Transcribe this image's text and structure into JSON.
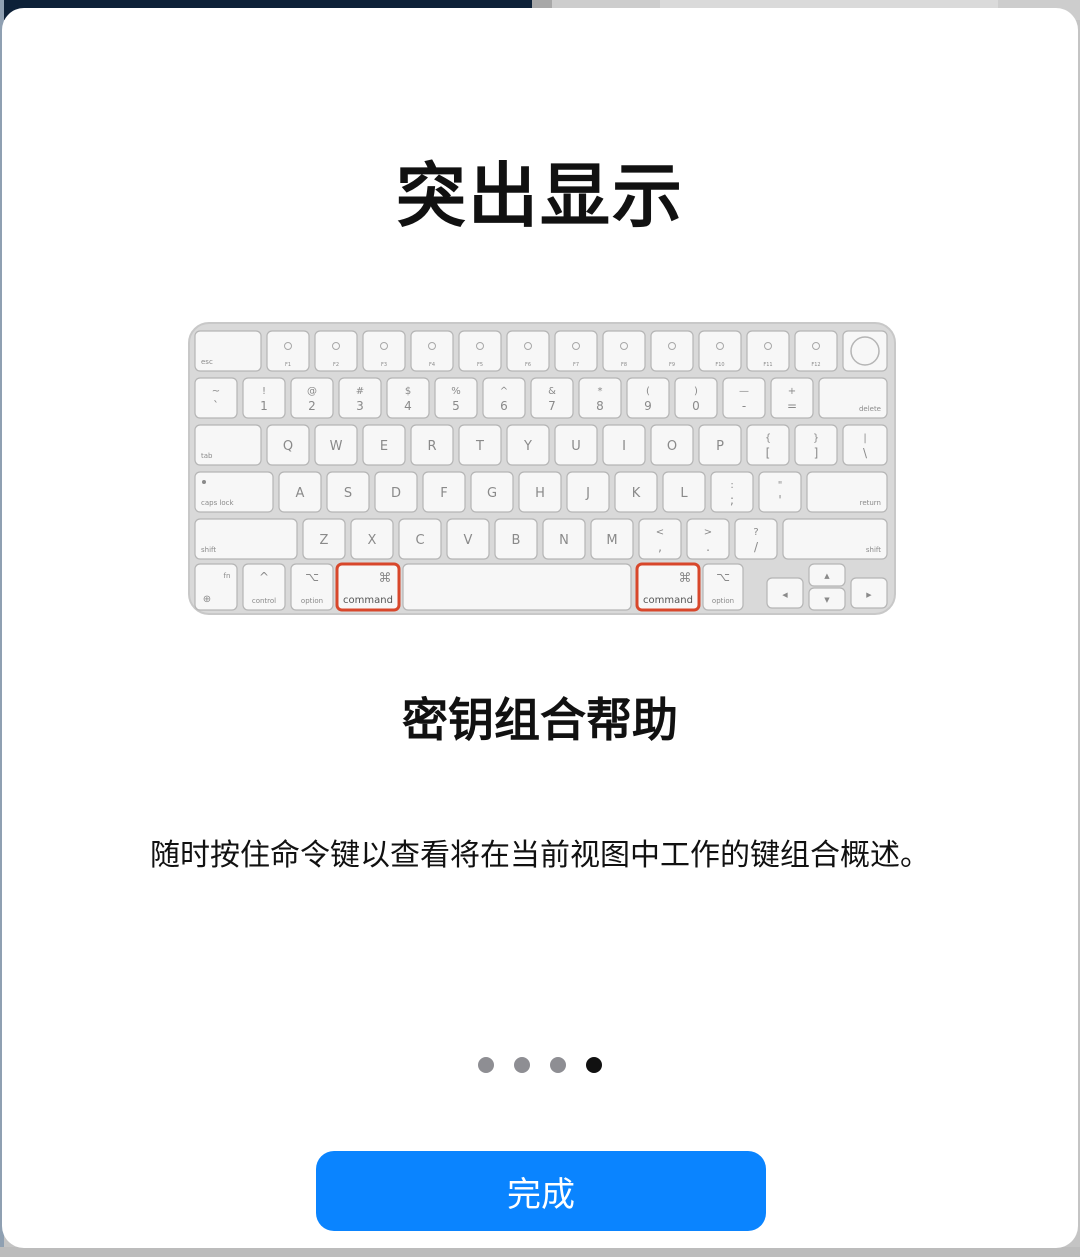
{
  "dialog": {
    "title": "突出显示",
    "subtitle": "密钥组合帮助",
    "description": "随时按住命令键以查看将在当前视图中工作的键组合概述。",
    "done_label": "完成",
    "active_page": 4,
    "page_count": 4
  },
  "colors": {
    "accent": "#0a84ff",
    "highlight": "#d8472b"
  },
  "keyboard": {
    "highlighted_label": "command",
    "highlighted_symbol": "⌘",
    "rows": [
      [
        "esc",
        "F1",
        "F2",
        "F3",
        "F4",
        "F5",
        "F6",
        "F7",
        "F8",
        "F9",
        "F10",
        "F11",
        "F12",
        "touch-id"
      ],
      [
        [
          "~",
          "`"
        ],
        [
          "!",
          "1"
        ],
        [
          "@",
          "2"
        ],
        [
          "#",
          "3"
        ],
        [
          "$",
          "4"
        ],
        [
          "%",
          "5"
        ],
        [
          "^",
          "6"
        ],
        [
          "&",
          "7"
        ],
        [
          "*",
          "8"
        ],
        [
          "(",
          "9"
        ],
        [
          ")",
          "0"
        ],
        [
          "—",
          "-"
        ],
        [
          "+",
          "="
        ],
        "delete"
      ],
      [
        "tab",
        "Q",
        "W",
        "E",
        "R",
        "T",
        "Y",
        "U",
        "I",
        "O",
        "P",
        [
          "{",
          "["
        ],
        [
          "}",
          "]"
        ],
        [
          "|",
          "\\"
        ]
      ],
      [
        "caps lock",
        "A",
        "S",
        "D",
        "F",
        "G",
        "H",
        "J",
        "K",
        "L",
        [
          ":",
          ";"
        ],
        [
          "\"",
          "'"
        ],
        "return"
      ],
      [
        "shift",
        "Z",
        "X",
        "C",
        "V",
        "B",
        "N",
        "M",
        [
          "<",
          ","
        ],
        [
          ">",
          "."
        ],
        [
          "?",
          "/"
        ],
        "shift"
      ],
      [
        "fn",
        "control",
        "option",
        "command",
        "space",
        "command",
        "option",
        "arrows"
      ]
    ]
  }
}
